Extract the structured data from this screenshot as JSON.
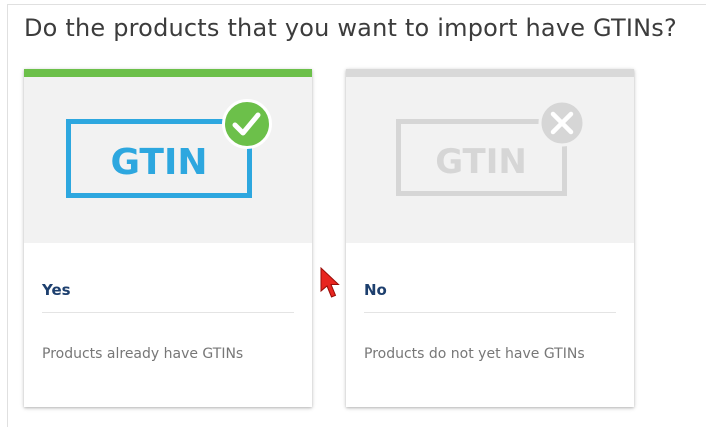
{
  "question": "Do the products that you want to import have GTINs?",
  "options": [
    {
      "badge_text": "GTIN",
      "badge_icon": "check-icon",
      "title": "Yes",
      "description": "Products already have GTINs",
      "selected": true,
      "accent_color": "#6cc04a",
      "badge_color": "#2da7df"
    },
    {
      "badge_text": "GTIN",
      "badge_icon": "x-icon",
      "title": "No",
      "description": "Products do not yet have GTINs",
      "selected": false,
      "accent_color": "#d9d9d9",
      "badge_color": "#d6d6d6"
    }
  ]
}
